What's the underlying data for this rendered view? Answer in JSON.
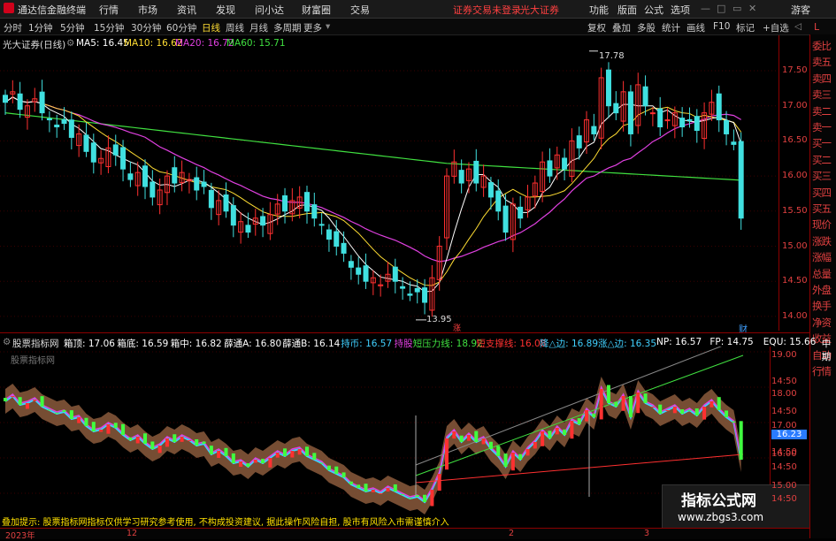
{
  "app": {
    "name": "通达信金融终端",
    "login_status": "证券交易未登录",
    "broker": "光大证券",
    "guest": "游客"
  },
  "menu": [
    "行情",
    "市场",
    "资讯",
    "发现",
    "问小达",
    "财富圈",
    "交易"
  ],
  "menu_right": [
    "功能",
    "版面",
    "公式",
    "选项"
  ],
  "periods": [
    "分时",
    "1分钟",
    "5分钟",
    "15分钟",
    "30分钟",
    "60分钟",
    "日线",
    "周线",
    "月线",
    "多周期",
    "更多"
  ],
  "active_period": "日线",
  "tools": [
    "复权",
    "叠加",
    "多股",
    "统计",
    "画线",
    "F10",
    "标记",
    "+自选"
  ],
  "stock": {
    "title": "光大证券(日线)"
  },
  "ma_legend": [
    {
      "label": "MA5: 16.45",
      "color": "#ffffff"
    },
    {
      "label": "MA10: 16.62",
      "color": "#ffdd33"
    },
    {
      "label": "MA20: 16.72",
      "color": "#e040e0"
    },
    {
      "label": "MA60: 15.71",
      "color": "#40e040"
    }
  ],
  "price_axis": [
    "17.50",
    "17.00",
    "16.50",
    "16.00",
    "15.50",
    "15.00",
    "14.50",
    "14.00"
  ],
  "annotations": {
    "high": "17.78",
    "low": "13.95",
    "rise_tag": "涨",
    "fin_tag": "财"
  },
  "indicator": {
    "name": "股票指标网",
    "watermark": "股票指标网",
    "values": [
      {
        "label": "箱顶: 17.06",
        "color": "#ffffff"
      },
      {
        "label": "箱底: 16.59",
        "color": "#ffffff"
      },
      {
        "label": "箱中: 16.82",
        "color": "#ffffff"
      },
      {
        "label": "薛通A: 16.80",
        "color": "#ffffff"
      },
      {
        "label": "薛通B: 16.14",
        "color": "#ffffff"
      },
      {
        "label": "持币: 16.57",
        "color": "#40d0ff"
      },
      {
        "label": "持股",
        "color": "#e040e0"
      },
      {
        "label": "短压力线: 18.92",
        "color": "#40e040"
      },
      {
        "label": "短支撑线: 16.08",
        "color": "#ff3030"
      },
      {
        "label": "降△边: 16.89",
        "color": "#40d0ff"
      },
      {
        "label": "涨△边: 16.35",
        "color": "#40d0ff"
      },
      {
        "label": "NP: 16.57",
        "color": "#ffffff"
      },
      {
        "label": "FP: 14.75",
        "color": "#ffffff"
      },
      {
        "label": "EQU: 15.66",
        "color": "#ffffff"
      },
      {
        "label": "中期",
        "color": "#ffffff"
      }
    ]
  },
  "indicator_axis": [
    "19.00",
    "14:50",
    "18.00",
    "14:50",
    "17.00",
    "16.23",
    "14:50",
    "16.00",
    "14:50",
    "15.00",
    "14:50"
  ],
  "current_price_tag": "16.23",
  "x_axis": [
    "2023年",
    "12",
    "2",
    "3"
  ],
  "sidebar": [
    "委比",
    "卖五",
    "卖四",
    "卖三",
    "卖二",
    "卖一",
    "买一",
    "买二",
    "买三",
    "买四",
    "买五",
    "现价",
    "涨跌",
    "涨幅",
    "总量",
    "外盘",
    "换手",
    "净资",
    "收益",
    "自动",
    "行情"
  ],
  "notice": "叠加提示: 股票指标网指标仅供学习研究参考使用, 不构成投资建议, 据此操作风险自担, 股市有风险入市需谨慎介入",
  "watermark": {
    "line1": "指标公式网",
    "line2": "www.zbgs3.com"
  },
  "colors": {
    "up": "#ff3030",
    "down": "#40e0e0",
    "ma5": "#ffffff",
    "ma10": "#ffdd33",
    "ma20": "#e040e0",
    "ma60": "#40e040",
    "band": "#8b5a3c"
  }
}
